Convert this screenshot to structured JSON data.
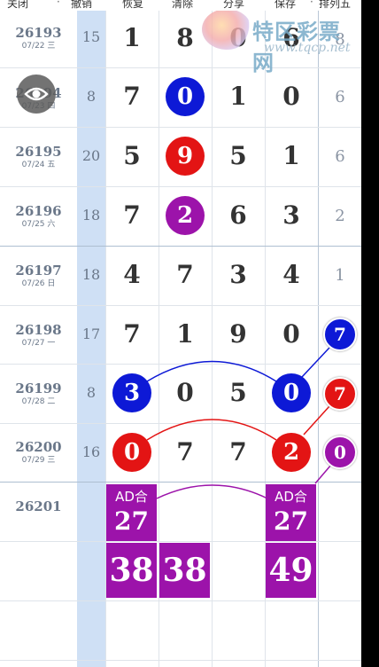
{
  "toolbar": [
    "关闭",
    "撤销",
    "恢复",
    "清除",
    "分享",
    "保存",
    "排列五"
  ],
  "watermark": {
    "title": "特区彩票网",
    "url": "www.tqcp.net"
  },
  "colors": {
    "blue": "#0d19d6",
    "red": "#e31414",
    "purple": "#9c13aa",
    "sum_column": "#cfe0f5"
  },
  "rows": [
    {
      "issue": "26193",
      "date": "07/22 三",
      "sum": "15",
      "digits": [
        "1",
        "8",
        "0",
        "6"
      ],
      "tail": "8"
    },
    {
      "issue": "26194",
      "date": "07/23 四",
      "sum": "8",
      "digits": [
        "7",
        "0",
        "1",
        "0"
      ],
      "tail": "6"
    },
    {
      "issue": "26195",
      "date": "07/24 五",
      "sum": "20",
      "digits": [
        "5",
        "9",
        "5",
        "1"
      ],
      "tail": "6"
    },
    {
      "issue": "26196",
      "date": "07/25 六",
      "sum": "18",
      "digits": [
        "7",
        "2",
        "6",
        "3"
      ],
      "tail": "2"
    },
    {
      "issue": "26197",
      "date": "07/26 日",
      "sum": "18",
      "digits": [
        "4",
        "7",
        "3",
        "4"
      ],
      "tail": "1"
    },
    {
      "issue": "26198",
      "date": "07/27 一",
      "sum": "17",
      "digits": [
        "7",
        "1",
        "9",
        "0"
      ],
      "tail": "7"
    },
    {
      "issue": "26199",
      "date": "07/28 二",
      "sum": "8",
      "digits": [
        "3",
        "0",
        "5",
        "0"
      ],
      "tail": "7"
    },
    {
      "issue": "26200",
      "date": "07/29 三",
      "sum": "16",
      "digits": [
        "0",
        "7",
        "7",
        "2"
      ],
      "tail": "0"
    },
    {
      "issue": "26201",
      "date": "",
      "sum": "",
      "digits": [
        "",
        "",
        "",
        ""
      ],
      "tail": ""
    }
  ],
  "predictions": {
    "ad_label": "AD合",
    "ad_left": "27",
    "ad_right": "27",
    "numbers": [
      "38",
      "38",
      "49"
    ]
  }
}
